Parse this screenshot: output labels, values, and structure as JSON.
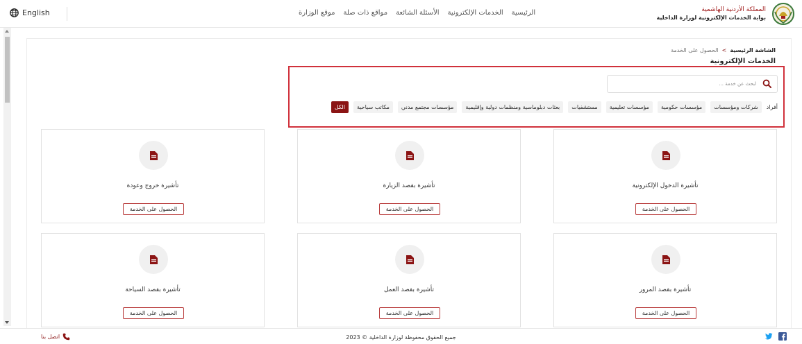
{
  "header": {
    "language": "English",
    "nav": [
      "الرئيسية",
      "الخدمات الإلكترونية",
      "الأسئلة الشائعة",
      "مواقع ذات صلة",
      "موقع الوزارة"
    ],
    "brand_line1": "المملكة الأردنية الهاشمية",
    "brand_line2": "بوابة الخدمات الإلكترونية لوزارة الداخلية"
  },
  "breadcrumb": {
    "home": "الشاشة الرئيسية",
    "separator": ">",
    "current": "الحصول على الخدمة"
  },
  "page_title": "الخدمات الإلكترونية",
  "search": {
    "placeholder": "ابحث عن خدمة ..."
  },
  "filters": [
    "أفراد",
    "شركات ومؤسسات",
    "مؤسسات حكومية",
    "مؤسسات تعليمية",
    "مستشفيات",
    "بعثات دبلوماسية ومنظمات دولية وإقليمية",
    "مؤسسات مجتمع مدني",
    "مكاتب سياحية",
    "الكل"
  ],
  "active_filter": "الكل",
  "cards": [
    {
      "title": "تأشيرة الدخول الإلكترونية",
      "button": "الحصول على الخدمة"
    },
    {
      "title": "تأشيرة بقصد الزيارة",
      "button": "الحصول على الخدمة"
    },
    {
      "title": "تأشيرة خروج وعودة",
      "button": "الحصول على الخدمة"
    },
    {
      "title": "تأشيرة بقصد المرور",
      "button": "الحصول على الخدمة"
    },
    {
      "title": "تأشيرة بقصد العمل",
      "button": "الحصول على الخدمة"
    },
    {
      "title": "تأشيرة بقصد السياحة",
      "button": "الحصول على الخدمة"
    }
  ],
  "footer": {
    "contact": "اتصل بنا",
    "copyright": "جميع الحقوق محفوظة لوزارة الداخلية © 2023"
  },
  "colors": {
    "accent": "#8b1414",
    "highlight": "#d0313b"
  },
  "icons": [
    "globe-icon",
    "search-icon",
    "document-icon",
    "phone-icon",
    "twitter-icon",
    "facebook-icon",
    "ministry-logo"
  ]
}
